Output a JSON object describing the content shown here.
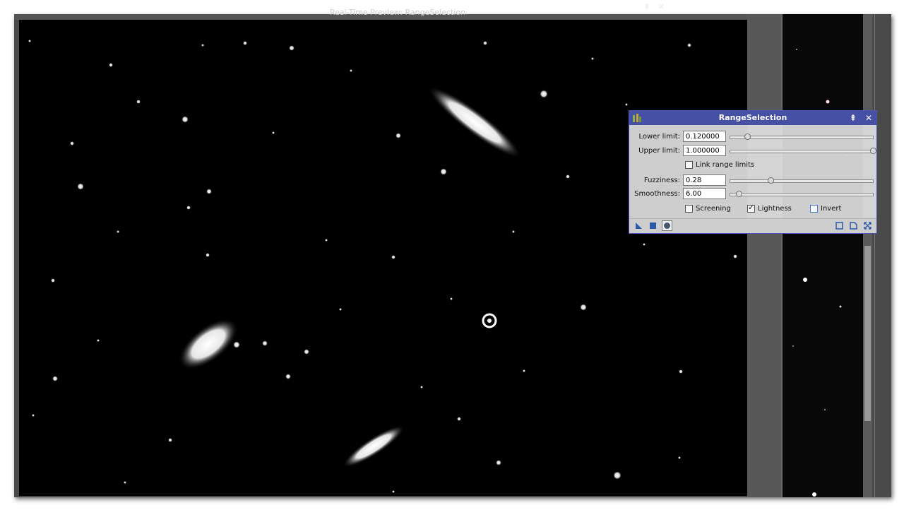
{
  "preview_window": {
    "title": "Real-Time Preview: RangeSelection",
    "pin_glyph": "⇞",
    "close_glyph": "✕"
  },
  "dialog": {
    "title": "RangeSelection",
    "collapse_glyph": "⇞",
    "close_glyph": "✕",
    "lower_limit": {
      "label": "Lower limit:",
      "value": "0.120000",
      "slider": 0.12
    },
    "upper_limit": {
      "label": "Upper limit:",
      "value": "1.000000",
      "slider": 1.0
    },
    "link_range_limits": {
      "label": "Link range limits",
      "checked": false
    },
    "fuzziness": {
      "label": "Fuzziness:",
      "value": "0.28",
      "slider": 0.28
    },
    "smoothness": {
      "label": "Smoothness:",
      "value": "6.00",
      "slider": 0.06
    },
    "screening": {
      "label": "Screening",
      "checked": false
    },
    "lightness": {
      "label": "Lightness",
      "checked": true
    },
    "invert": {
      "label": "Invert",
      "checked": false
    },
    "bottom_icons": {
      "new_instance": "triangle-icon",
      "apply_global": "square-icon",
      "real_time_preview": "circle-icon",
      "browse_docs": "square-outline-icon",
      "reset": "document-icon",
      "expand": "expand-arrows-icon"
    }
  },
  "colors": {
    "dialog_title_bar": "#4651a6",
    "slider_track": "#e7e7e7",
    "preview_background": "#000000"
  }
}
